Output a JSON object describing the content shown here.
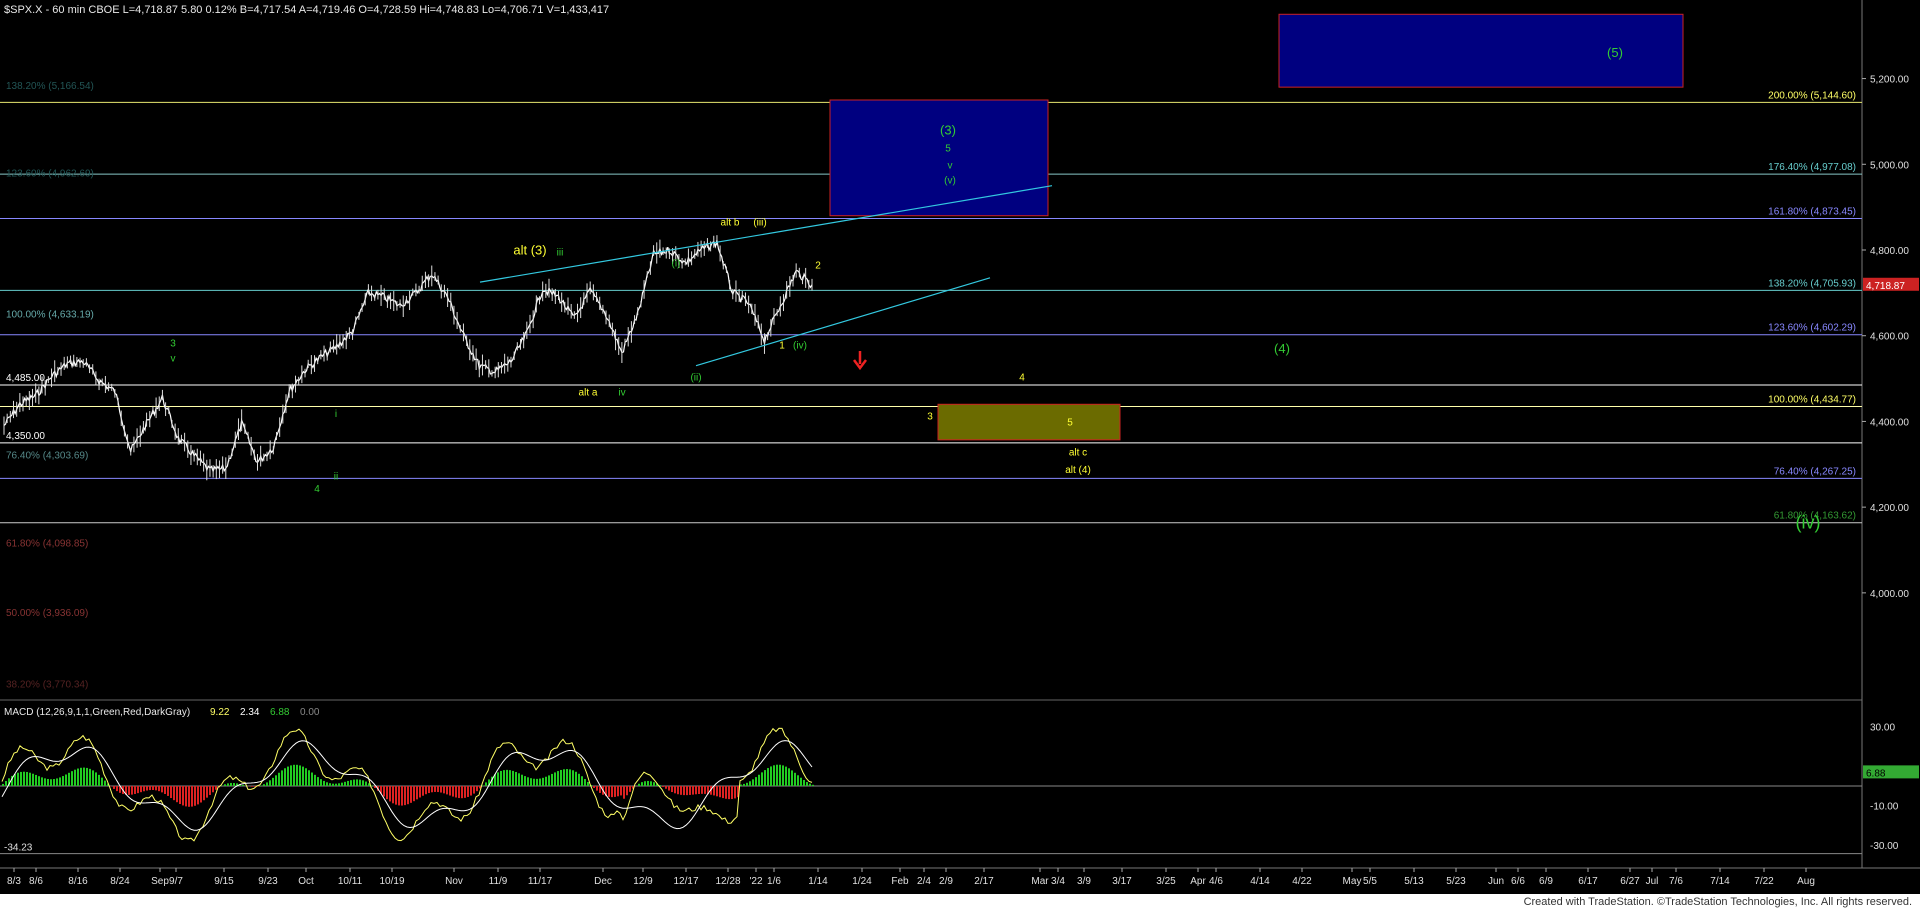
{
  "header": {
    "text": "$SPX.X - 60 min  CBOE  L=4,718.87  5.80  0.12%  B=4,717.54  A=4,719.46  O=4,728.59  Hi=4,748.83  Lo=4,706.71  V=1,433,417"
  },
  "footer": {
    "credit": "Created with TradeStation. ©TradeStation Technologies, Inc. All rights reserved."
  },
  "colors": {
    "background": "#000000",
    "price": "#ffffff",
    "green_label": "#33cc33",
    "yellow_label": "#ffff33",
    "blue_box": "#000080",
    "box_border": "#cc2222",
    "olive_box": "#6b6b00",
    "trend": "#33c9e0",
    "macd_up": "#22cc22",
    "macd_down": "#dd2222"
  },
  "chart_data": {
    "type": "line",
    "title": "$SPX.X - 60 min",
    "ylim": [
      3750,
      5360
    ],
    "y_ticks": [
      "5,200.00",
      "5,000.00",
      "4,800.00",
      "4,600.00",
      "4,400.00",
      "4,200.00",
      "4,000.00"
    ],
    "y_tick_values": [
      5200,
      5000,
      4800,
      4600,
      4400,
      4200,
      4000
    ],
    "x_ticks": [
      "8/3",
      "8/6",
      "8/16",
      "8/24",
      "Sep",
      "9/7",
      "9/15",
      "9/23",
      "Oct",
      "10/11",
      "10/19",
      "Nov",
      "11/9",
      "11/17",
      "Dec",
      "12/9",
      "12/17",
      "12/28",
      "'22",
      "1/6",
      "1/14",
      "1/24",
      "Feb",
      "2/4",
      "2/9",
      "2/17",
      "Mar",
      "3/4",
      "3/9",
      "3/17",
      "3/25",
      "Apr",
      "4/6",
      "4/14",
      "4/22",
      "May",
      "5/5",
      "5/13",
      "5/23",
      "Jun",
      "6/6",
      "6/9",
      "6/17",
      "6/27",
      "Jul",
      "7/6",
      "7/14",
      "7/22",
      "Aug"
    ],
    "last_price_label": "4,718.87",
    "price_points": [
      [
        "8/3",
        4390
      ],
      [
        "8/12",
        4440
      ],
      [
        "8/20",
        4460
      ],
      [
        "8/27",
        4505
      ],
      [
        "Sep 2",
        4535
      ],
      [
        "Sep 7",
        4540
      ],
      [
        "9/10",
        4495
      ],
      [
        "9/14",
        4470
      ],
      [
        "9/20",
        4330
      ],
      [
        "9/22",
        4395
      ],
      [
        "9/24",
        4455
      ],
      [
        "9/28",
        4360
      ],
      [
        "Oct 1",
        4320
      ],
      [
        "Oct 4",
        4285
      ],
      [
        "Oct 6",
        4290
      ],
      [
        "Oct 8",
        4395
      ],
      [
        "10/12",
        4305
      ],
      [
        "10/13",
        4340
      ],
      [
        "10/15",
        4470
      ],
      [
        "10/19",
        4520
      ],
      [
        "10/22",
        4550
      ],
      [
        "10/27",
        4575
      ],
      [
        "Nov 1",
        4610
      ],
      [
        "Nov 5",
        4700
      ],
      [
        "11/9",
        4690
      ],
      [
        "11/12",
        4670
      ],
      [
        "11/17",
        4700
      ],
      [
        "11/22",
        4745
      ],
      [
        "11/24",
        4690
      ],
      [
        "11/26",
        4600
      ],
      [
        "11/30",
        4530
      ],
      [
        "Dec 1",
        4515
      ],
      [
        "Dec 3",
        4540
      ],
      [
        "Dec 6",
        4605
      ],
      [
        "12/9",
        4710
      ],
      [
        "12/10",
        4690
      ],
      [
        "12/14",
        4640
      ],
      [
        "12/16",
        4705
      ],
      [
        "12/17",
        4650
      ],
      [
        "12/20",
        4560
      ],
      [
        "12/22",
        4650
      ],
      [
        "12/27",
        4790
      ],
      [
        "12/29",
        4800
      ],
      [
        "12/31",
        4770
      ],
      [
        "'22 Jan 3",
        4800
      ],
      [
        "Jan 4",
        4818
      ],
      [
        "Jan 5",
        4700
      ],
      [
        "1/7",
        4675
      ],
      [
        "1/10",
        4590
      ],
      [
        "1/11",
        4670
      ],
      [
        "1/12",
        4750
      ],
      [
        "1/13",
        4719
      ]
    ],
    "horizontal_levels": [
      {
        "label": "200.00% (5,144.60)",
        "value": 5144.6
      },
      {
        "label": "176.40% (4,977.08)",
        "value": 4977.08
      },
      {
        "label": "161.80% (4,873.45)",
        "value": 4873.45
      },
      {
        "label": "138.20% (4,705.93)",
        "value": 4705.93
      },
      {
        "label": "123.60% (4,602.29)",
        "value": 4602.29
      },
      {
        "label": "100.00% (4,434.77)",
        "value": 4434.77
      },
      {
        "label": "76.40% (4,267.25)",
        "value": 4267.25
      },
      {
        "label": "61.80% (4,163.62)",
        "value": 4163.62
      }
    ],
    "left_levels": [
      {
        "label": "138.20% (5,166.54)",
        "value": 5166.54
      },
      {
        "label": "123.60% (4,962.69)",
        "value": 4962.69
      },
      {
        "label": "100.00% (4,633.19)",
        "value": 4633.19
      },
      {
        "label": "4,485.00",
        "value": 4485
      },
      {
        "label": "4,350.00",
        "value": 4350
      },
      {
        "label": "76.40% (4,303.69)",
        "value": 4303.69
      },
      {
        "label": "61.80% (4,098.85)",
        "value": 4098.85
      },
      {
        "label": "50.00% (3,936.09)",
        "value": 3936.09
      },
      {
        "label": "38.20% (3,770.34)",
        "value": 3770.34
      }
    ],
    "wave_labels": [
      {
        "text": "(5)",
        "color": "green",
        "x": "Jun 6/6",
        "y": 5250
      },
      {
        "text": "(3)",
        "color": "green",
        "x": "2/9",
        "y": 5070
      },
      {
        "text": "5",
        "color": "green",
        "x": "2/9",
        "y": 5030
      },
      {
        "text": "v",
        "color": "green",
        "x": "2/9",
        "y": 4990
      },
      {
        "text": "(v)",
        "color": "green",
        "x": "2/9",
        "y": 4955
      },
      {
        "text": "alt b",
        "color": "yellow",
        "x": "12/28",
        "y": 4857
      },
      {
        "text": "(iii)",
        "color": "yellow",
        "x": "12/31",
        "y": 4857
      },
      {
        "text": "alt (3)",
        "color": "yellow",
        "x": "11/12",
        "y": 4790
      },
      {
        "text": "iii",
        "color": "green",
        "x": "11/24",
        "y": 4787
      },
      {
        "text": "(i)",
        "color": "green",
        "x": "12/16",
        "y": 4762
      },
      {
        "text": "2",
        "color": "yellow",
        "x": "1/14",
        "y": 4757
      },
      {
        "text": "3",
        "color": "green",
        "x": "Sep 4",
        "y": 4575
      },
      {
        "text": "v",
        "color": "green",
        "x": "Sep 4",
        "y": 4540
      },
      {
        "text": "1",
        "color": "yellow",
        "x": "1/7",
        "y": 4570
      },
      {
        "text": "(iv)",
        "color": "green",
        "x": "1/11",
        "y": 4570
      },
      {
        "text": "(4)",
        "color": "green",
        "x": "4/14",
        "y": 4560
      },
      {
        "text": "(ii)",
        "color": "green",
        "x": "12/20",
        "y": 4495
      },
      {
        "text": "4",
        "color": "yellow",
        "x": "Mar",
        "y": 4495
      },
      {
        "text": "alt a",
        "color": "yellow",
        "x": "Dec 1",
        "y": 4460
      },
      {
        "text": "iv",
        "color": "green",
        "x": "Dec 5",
        "y": 4460
      },
      {
        "text": "i",
        "color": "green",
        "x": "10/11",
        "y": 4410
      },
      {
        "text": "3",
        "color": "yellow",
        "x": "2/9",
        "y": 4405
      },
      {
        "text": "5",
        "color": "yellow",
        "x": "3/17",
        "y": 4390
      },
      {
        "text": "alt c",
        "color": "yellow",
        "x": "3/17",
        "y": 4320
      },
      {
        "text": "alt (4)",
        "color": "yellow",
        "x": "3/17",
        "y": 4280
      },
      {
        "text": "4",
        "color": "green",
        "x": "Oct 6",
        "y": 4235
      },
      {
        "text": "ii",
        "color": "green",
        "x": "10/12",
        "y": 4265
      },
      {
        "text": "(iv)",
        "color": "green",
        "x": "Aug",
        "y": 4150
      }
    ],
    "target_boxes": [
      {
        "name": "wave (5) target",
        "from": "Apr 4/14",
        "to": "Jul 7/6",
        "y_low": 5180,
        "y_high": 5350
      },
      {
        "name": "wave (3) target",
        "from": "1/24",
        "to": "Feb 2/17",
        "y_low": 4880,
        "y_high": 5150
      },
      {
        "name": "alt (4) support",
        "from": "Feb 2/9",
        "to": "3/17",
        "y_low": 4357,
        "y_high": 4440
      }
    ],
    "trend_channel": [
      {
        "from": [
          "11/5",
          4725
        ],
        "to": [
          "Feb 2/9",
          4950
        ]
      },
      {
        "from": [
          "12/20",
          4530
        ],
        "to": [
          "Feb 2/17",
          4735
        ]
      }
    ],
    "macd": {
      "title": "MACD (12,26,9,1,1,Green,Red,DarkGray)",
      "values_text": [
        "9.22",
        "2.34",
        "6.88",
        "0.00"
      ],
      "ylim": [
        -40,
        42
      ],
      "y_ticks": [
        "30.00",
        "-10.00",
        "-30.00"
      ],
      "y_tick_values": [
        30,
        -10,
        -30
      ],
      "left_label": "-34.23",
      "last_value": "6.88"
    }
  }
}
